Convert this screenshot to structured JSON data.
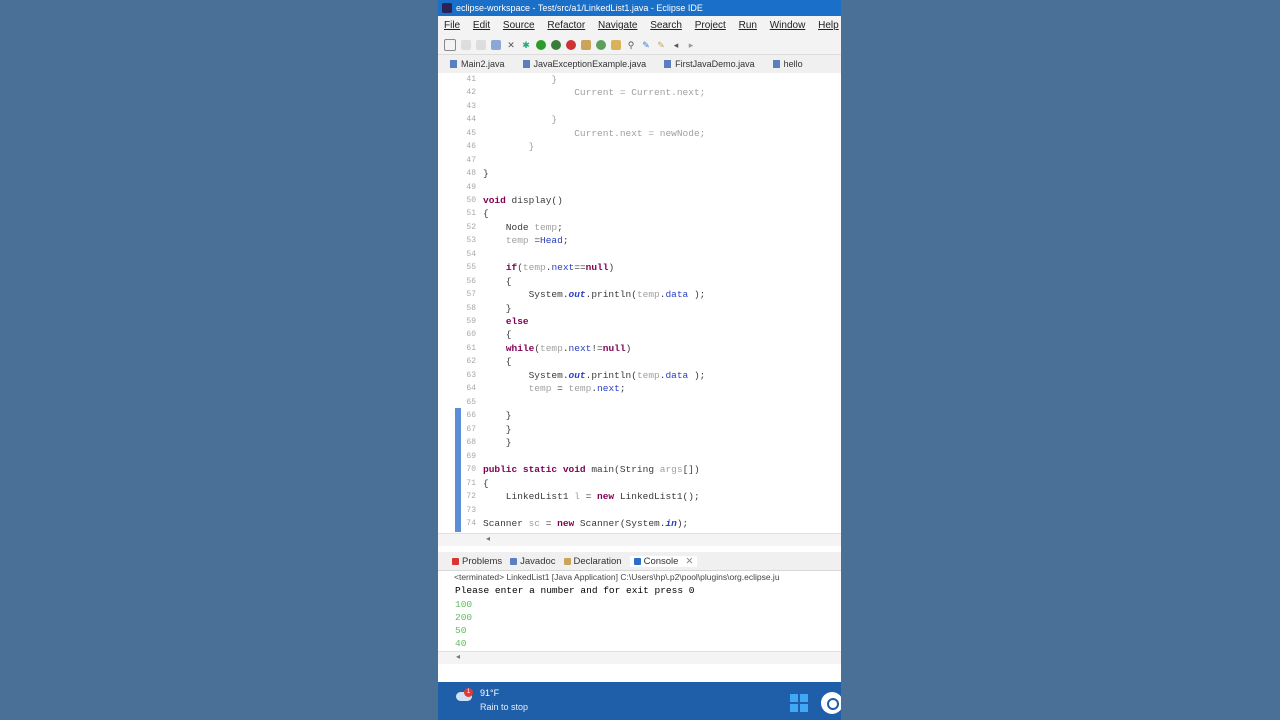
{
  "window": {
    "title": "eclipse-workspace - Test/src/a1/LinkedList1.java - Eclipse IDE"
  },
  "menu": [
    "File",
    "Edit",
    "Source",
    "Refactor",
    "Navigate",
    "Search",
    "Project",
    "Run",
    "Window",
    "Help"
  ],
  "tabs": [
    "Main2.java",
    "JavaExceptionExample.java",
    "FirstJavaDemo.java",
    "hello"
  ],
  "editor": {
    "lines": [
      {
        "n": "41",
        "html": "            <span class=\"dim\">}</span>"
      },
      {
        "n": "42",
        "html": "                <span class=\"dim\">Current = Current.</span><span class=\"fld dim\">next</span><span class=\"dim\">;</span>"
      },
      {
        "n": "43",
        "html": ""
      },
      {
        "n": "44",
        "html": "            <span class=\"dim\">}</span>"
      },
      {
        "n": "45",
        "html": "                <span class=\"dim\">Current.</span><span class=\"fld dim\">next</span><span class=\"dim\"> = newNode;</span>"
      },
      {
        "n": "46",
        "html": "        <span class=\"dim\">}</span>"
      },
      {
        "n": "47",
        "html": ""
      },
      {
        "n": "48",
        "html": "}"
      },
      {
        "n": "49",
        "html": ""
      },
      {
        "n": "50",
        "html": "<span class=\"kw\">void</span> display()"
      },
      {
        "n": "51",
        "html": "{"
      },
      {
        "n": "52",
        "html": "    Node <span class=\"dim\">temp</span>;"
      },
      {
        "n": "53",
        "html": "    <span class=\"dim\">temp</span> =<span class=\"fld\">Head</span>;"
      },
      {
        "n": "54",
        "html": ""
      },
      {
        "n": "55",
        "html": "    <span class=\"kw\">if</span>(<span class=\"dim\">temp</span>.<span class=\"fld\">next</span>==<span class=\"kw\">null</span>)"
      },
      {
        "n": "56",
        "html": "    {"
      },
      {
        "n": "57",
        "html": "        System.<span class=\"fld\"><b><i>out</i></b></span>.println(<span class=\"dim\">temp</span>.<span class=\"fld\">data</span> );"
      },
      {
        "n": "58",
        "html": "    }"
      },
      {
        "n": "59",
        "html": "    <span class=\"kw\">else</span>"
      },
      {
        "n": "60",
        "html": "    {"
      },
      {
        "n": "61",
        "html": "    <span class=\"kw\">while</span>(<span class=\"dim\">temp</span>.<span class=\"fld\">next</span>!=<span class=\"kw\">null</span>)"
      },
      {
        "n": "62",
        "html": "    {"
      },
      {
        "n": "63",
        "html": "        System.<span class=\"fld\"><b><i>out</i></b></span>.println(<span class=\"dim\">temp</span>.<span class=\"fld\">data</span> );"
      },
      {
        "n": "64",
        "html": "        <span class=\"dim\">temp</span> = <span class=\"dim\">temp</span>.<span class=\"fld\">next</span>;"
      },
      {
        "n": "65",
        "html": ""
      },
      {
        "n": "66",
        "html": "    }"
      },
      {
        "n": "67",
        "html": "    }"
      },
      {
        "n": "68",
        "html": "    }"
      },
      {
        "n": "69",
        "html": ""
      },
      {
        "n": "70",
        "html": "<span class=\"kw\">public static void</span> main(String <span class=\"dim\">args</span>[])"
      },
      {
        "n": "71",
        "html": "{"
      },
      {
        "n": "72",
        "html": "    LinkedList1 <span class=\"dim\">l</span> = <span class=\"kw\">new</span> LinkedList1();"
      },
      {
        "n": "73",
        "html": ""
      },
      {
        "n": "74",
        "html": "Scanner <span class=\"dim\">sc</span> = <span class=\"kw\">new</span> Scanner(System.<span class=\"fld\"><b><i>in</i></b></span>);"
      }
    ]
  },
  "console": {
    "tabs": [
      "Problems",
      "Javadoc",
      "Declaration",
      "Console"
    ],
    "status": "<terminated> LinkedList1 [Java Application] C:\\Users\\hp\\.p2\\pool\\plugins\\org.eclipse.ju",
    "prompt": "Please enter a number and for exit press 0",
    "inputs": [
      "100",
      "200",
      "50",
      "40"
    ]
  },
  "taskbar": {
    "temperature": "91°F",
    "weather_text": "Rain to stop",
    "notification_count": "1"
  }
}
